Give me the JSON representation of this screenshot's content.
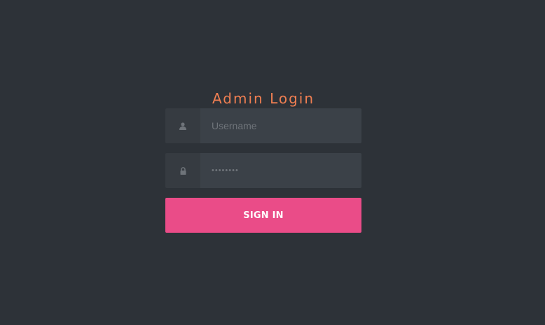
{
  "login": {
    "title": "Admin Login",
    "username": {
      "value": "",
      "placeholder": "Username",
      "icon": "user-icon"
    },
    "password": {
      "value": "••••••••",
      "icon": "lock-icon"
    },
    "submit_label": "SIGN IN"
  },
  "colors": {
    "background": "#2d3238",
    "title": "#f07f52",
    "field_bg": "#3b4148",
    "icon_bg": "#363b41",
    "button": "#ea4c88"
  }
}
